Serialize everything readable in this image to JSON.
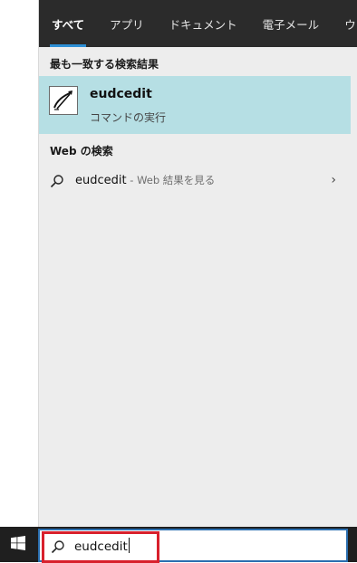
{
  "tabs": [
    {
      "label": "すべて",
      "active": true
    },
    {
      "label": "アプリ",
      "active": false
    },
    {
      "label": "ドキュメント",
      "active": false
    },
    {
      "label": "電子メール",
      "active": false
    },
    {
      "label": "ウェブ",
      "active": false
    }
  ],
  "best_match": {
    "section_title": "最も一致する検索結果",
    "name": "eudcedit",
    "subtitle": "コマンドの実行",
    "icon": "pen-editor-icon"
  },
  "web_search": {
    "section_title": "Web の検索",
    "query": "eudcedit",
    "suffix": " - Web 結果を見る",
    "chevron": "›"
  },
  "taskbar": {
    "search_value": "eudcedit",
    "start_icon": "windows-logo-icon"
  },
  "colors": {
    "tab_bar": "#2b2b2b",
    "active_underline": "#2d8fd5",
    "best_match_bg": "#b6dfe4",
    "panel_bg": "#ededed",
    "highlight_border": "#d8202c",
    "search_border": "#2b6fb0"
  }
}
